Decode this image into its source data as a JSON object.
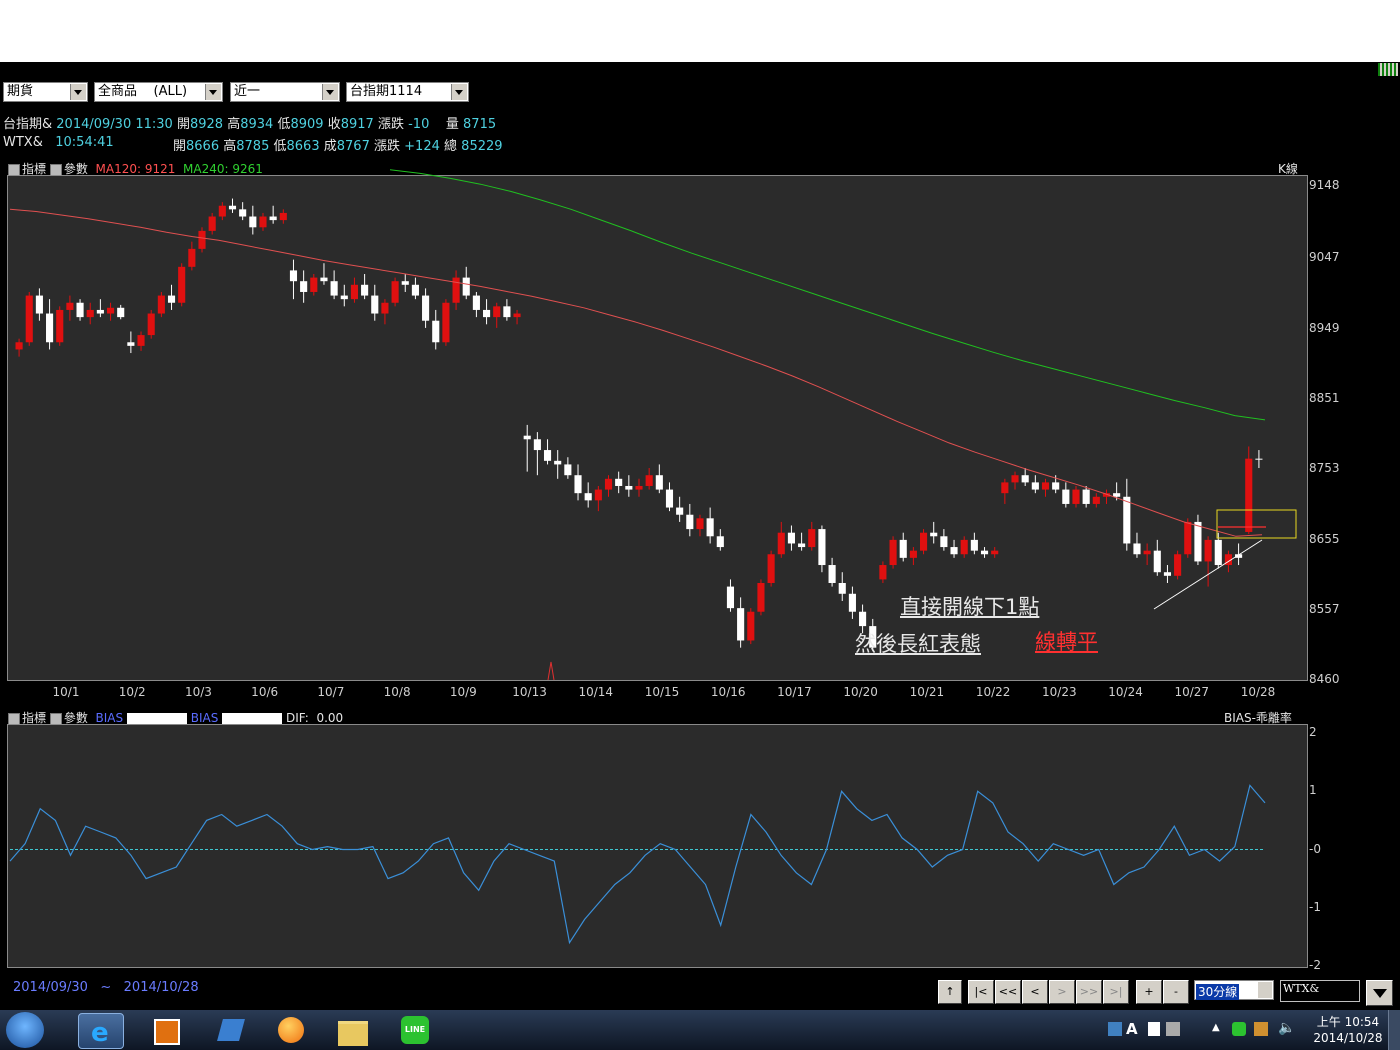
{
  "toolbar": {
    "combo1": "期貨",
    "combo2": "全商品    (ALL)",
    "combo3": "近一",
    "combo4": "台指期1114"
  },
  "quote1": {
    "name": "台指期&",
    "datetime": "2014/09/30 11:30",
    "open_label": "開",
    "open": "8928",
    "high_label": "高",
    "high": "8934",
    "low_label": "低",
    "low": "8909",
    "close_label": "收",
    "close": "8917",
    "chg_label": "漲跌",
    "chg": "-10",
    "vol_label": "量",
    "vol": "8715"
  },
  "quote2": {
    "name": "WTX&",
    "time": "10:54:41",
    "open_label": "開",
    "open": "8666",
    "high_label": "高",
    "high": "8785",
    "low_label": "低",
    "low": "8663",
    "close_label": "成",
    "close": "8767",
    "chg_label": "漲跌",
    "chg": "+124",
    "vol_label": "總",
    "vol": "85229"
  },
  "main_header": {
    "ind_label": "指標",
    "param_label": "參數",
    "ma120": "MA120: 9121",
    "ma240": "MA240: 9261",
    "chart_kind": "K線"
  },
  "sub_header": {
    "ind_label": "指標",
    "param_label": "參數",
    "bias1": "BIAS",
    "bias2": "BIAS",
    "dif_label": "DIF:",
    "dif": "0.00",
    "name": "BIAS-乖離率"
  },
  "annotations": {
    "line1": "直接開線下1點",
    "line2": "然後長紅表態",
    "line3": "線轉平"
  },
  "range": {
    "start": "2014/09/30",
    "sep": "~",
    "end": "2014/10/28"
  },
  "nav": {
    "up": "↑",
    "first": "|<",
    "prev_page": "<<",
    "prev": "<",
    "next": ">",
    "next_page": ">>",
    "last": ">|",
    "zoom_in": "+",
    "zoom_out": "-",
    "period": "30分線",
    "symbol": "WTX&"
  },
  "taskbar": {
    "clock_time": "上午 10:54",
    "clock_date": "2014/10/28"
  },
  "colors": {
    "up": "#e01010",
    "down": "#ffffff",
    "ma120": "#e05050",
    "ma240": "#20c020",
    "bias": "#3a8fd8",
    "zero": "#3fc7d0",
    "highlight": "#e8d820"
  },
  "chart_data": [
    {
      "type": "candlestick",
      "y_axis_ticks": [
        "9148",
        "9047",
        "8949",
        "8851",
        "8753",
        "8655",
        "8557",
        "8460"
      ],
      "ylim": [
        8460,
        9160
      ],
      "x_tick_labels": [
        "10/1",
        "10/2",
        "10/3",
        "10/6",
        "10/7",
        "10/8",
        "10/9",
        "10/13",
        "10/14",
        "10/15",
        "10/16",
        "10/17",
        "10/20",
        "10/21",
        "10/22",
        "10/23",
        "10/24",
        "10/27",
        "10/28"
      ],
      "candles": [
        [
          8920,
          8935,
          8910,
          8930
        ],
        [
          8930,
          9000,
          8925,
          8995
        ],
        [
          8995,
          9005,
          8960,
          8970
        ],
        [
          8970,
          8990,
          8920,
          8930
        ],
        [
          8930,
          8980,
          8925,
          8975
        ],
        [
          8975,
          8995,
          8960,
          8985
        ],
        [
          8985,
          8990,
          8960,
          8965
        ],
        [
          8965,
          8985,
          8955,
          8975
        ],
        [
          8975,
          8990,
          8965,
          8970
        ],
        [
          8970,
          8985,
          8960,
          8978
        ],
        [
          8978,
          8982,
          8962,
          8965
        ],
        [
          8930,
          8945,
          8915,
          8925
        ],
        [
          8925,
          8945,
          8918,
          8940
        ],
        [
          8940,
          8975,
          8935,
          8970
        ],
        [
          8970,
          9000,
          8965,
          8995
        ],
        [
          8995,
          9010,
          8975,
          8985
        ],
        [
          8985,
          9040,
          8980,
          9035
        ],
        [
          9035,
          9070,
          9030,
          9060
        ],
        [
          9060,
          9090,
          9055,
          9085
        ],
        [
          9085,
          9110,
          9080,
          9105
        ],
        [
          9105,
          9125,
          9100,
          9120
        ],
        [
          9120,
          9130,
          9110,
          9115
        ],
        [
          9115,
          9125,
          9100,
          9105
        ],
        [
          9105,
          9120,
          9080,
          9090
        ],
        [
          9090,
          9110,
          9085,
          9105
        ],
        [
          9105,
          9120,
          9095,
          9100
        ],
        [
          9100,
          9115,
          9095,
          9110
        ],
        [
          9030,
          9045,
          8990,
          9015
        ],
        [
          9015,
          9030,
          8985,
          9000
        ],
        [
          9000,
          9025,
          8995,
          9020
        ],
        [
          9020,
          9040,
          9010,
          9015
        ],
        [
          9015,
          9030,
          8990,
          8995
        ],
        [
          8995,
          9010,
          8980,
          8990
        ],
        [
          8990,
          9020,
          8985,
          9010
        ],
        [
          9010,
          9025,
          8990,
          8995
        ],
        [
          8995,
          9010,
          8960,
          8970
        ],
        [
          8970,
          8990,
          8955,
          8985
        ],
        [
          8985,
          9020,
          8980,
          9015
        ],
        [
          9015,
          9025,
          9000,
          9010
        ],
        [
          9010,
          9020,
          8990,
          8995
        ],
        [
          8995,
          9005,
          8950,
          8960
        ],
        [
          8960,
          8975,
          8920,
          8930
        ],
        [
          8930,
          8990,
          8925,
          8985
        ],
        [
          8985,
          9030,
          8975,
          9020
        ],
        [
          9020,
          9035,
          8990,
          8995
        ],
        [
          8995,
          9000,
          8965,
          8975
        ],
        [
          8975,
          8990,
          8955,
          8965
        ],
        [
          8965,
          8985,
          8950,
          8980
        ],
        [
          8980,
          8990,
          8960,
          8965
        ],
        [
          8965,
          8975,
          8955,
          8970
        ],
        [
          8800,
          8815,
          8750,
          8795
        ],
        [
          8795,
          8805,
          8745,
          8780
        ],
        [
          8780,
          8795,
          8760,
          8765
        ],
        [
          8765,
          8780,
          8740,
          8760
        ],
        [
          8760,
          8770,
          8740,
          8745
        ],
        [
          8745,
          8760,
          8710,
          8720
        ],
        [
          8720,
          8735,
          8700,
          8710
        ],
        [
          8710,
          8730,
          8695,
          8725
        ],
        [
          8725,
          8745,
          8715,
          8740
        ],
        [
          8740,
          8750,
          8720,
          8730
        ],
        [
          8730,
          8745,
          8715,
          8725
        ],
        [
          8725,
          8740,
          8715,
          8730
        ],
        [
          8730,
          8755,
          8725,
          8745
        ],
        [
          8745,
          8760,
          8720,
          8725
        ],
        [
          8725,
          8735,
          8695,
          8700
        ],
        [
          8700,
          8715,
          8680,
          8690
        ],
        [
          8690,
          8705,
          8660,
          8670
        ],
        [
          8670,
          8690,
          8660,
          8685
        ],
        [
          8685,
          8700,
          8650,
          8660
        ],
        [
          8660,
          8670,
          8640,
          8645
        ],
        [
          8590,
          8600,
          8555,
          8560
        ],
        [
          8560,
          8575,
          8505,
          8515
        ],
        [
          8515,
          8560,
          8510,
          8555
        ],
        [
          8555,
          8600,
          8550,
          8595
        ],
        [
          8595,
          8640,
          8590,
          8635
        ],
        [
          8635,
          8680,
          8630,
          8665
        ],
        [
          8665,
          8675,
          8640,
          8650
        ],
        [
          8650,
          8665,
          8640,
          8645
        ],
        [
          8645,
          8680,
          8640,
          8670
        ],
        [
          8670,
          8675,
          8610,
          8620
        ],
        [
          8620,
          8630,
          8590,
          8595
        ],
        [
          8595,
          8610,
          8570,
          8580
        ],
        [
          8580,
          8590,
          8545,
          8555
        ],
        [
          8555,
          8565,
          8525,
          8535
        ],
        [
          8535,
          8545,
          8500,
          8505
        ],
        [
          8600,
          8625,
          8595,
          8620
        ],
        [
          8620,
          8660,
          8615,
          8655
        ],
        [
          8655,
          8665,
          8625,
          8630
        ],
        [
          8630,
          8645,
          8620,
          8640
        ],
        [
          8640,
          8670,
          8635,
          8665
        ],
        [
          8665,
          8680,
          8650,
          8660
        ],
        [
          8660,
          8670,
          8640,
          8645
        ],
        [
          8645,
          8655,
          8630,
          8635
        ],
        [
          8635,
          8660,
          8630,
          8655
        ],
        [
          8655,
          8665,
          8635,
          8640
        ],
        [
          8640,
          8645,
          8630,
          8635
        ],
        [
          8635,
          8645,
          8630,
          8640
        ],
        [
          8720,
          8740,
          8705,
          8735
        ],
        [
          8735,
          8750,
          8725,
          8745
        ],
        [
          8745,
          8755,
          8730,
          8735
        ],
        [
          8735,
          8745,
          8720,
          8725
        ],
        [
          8725,
          8740,
          8715,
          8735
        ],
        [
          8735,
          8745,
          8720,
          8725
        ],
        [
          8725,
          8735,
          8700,
          8705
        ],
        [
          8705,
          8730,
          8700,
          8725
        ],
        [
          8725,
          8730,
          8700,
          8705
        ],
        [
          8705,
          8720,
          8700,
          8715
        ],
        [
          8715,
          8725,
          8705,
          8720
        ],
        [
          8720,
          8735,
          8710,
          8715
        ],
        [
          8715,
          8740,
          8640,
          8650
        ],
        [
          8650,
          8665,
          8630,
          8635
        ],
        [
          8635,
          8650,
          8620,
          8640
        ],
        [
          8640,
          8655,
          8605,
          8610
        ],
        [
          8610,
          8620,
          8595,
          8605
        ],
        [
          8605,
          8640,
          8600,
          8635
        ],
        [
          8635,
          8685,
          8630,
          8680
        ],
        [
          8680,
          8690,
          8620,
          8625
        ],
        [
          8625,
          8660,
          8590,
          8655
        ],
        [
          8655,
          8665,
          8615,
          8620
        ],
        [
          8620,
          8640,
          8610,
          8635
        ],
        [
          8635,
          8650,
          8620,
          8630
        ],
        [
          8666,
          8785,
          8663,
          8768
        ],
        [
          8768,
          8780,
          8755,
          8767
        ]
      ],
      "series": [
        {
          "name": "MA120",
          "values": [
            9115,
            9112,
            9107,
            9102,
            9096,
            9090,
            9083,
            9077,
            9072,
            9065,
            9058,
            9051,
            9044,
            9038,
            9032,
            9026,
            9020,
            9014,
            9008,
            9001,
            8994,
            8986,
            8978,
            8968,
            8958,
            8947,
            8935,
            8923,
            8910,
            8897,
            8883,
            8868,
            8852,
            8836,
            8820,
            8805,
            8790,
            8777,
            8765,
            8753,
            8742,
            8731,
            8719,
            8706,
            8693,
            8680,
            8670,
            8660,
            8662
          ]
        },
        {
          "name": "MA240",
          "values": [
            9170,
            9165,
            9158,
            9150,
            9140,
            9128,
            9115,
            9100,
            9085,
            9069,
            9054,
            9040,
            9026,
            9012,
            8998,
            8984,
            8970,
            8956,
            8942,
            8929,
            8916,
            8904,
            8893,
            8882,
            8871,
            8860,
            8849,
            8839,
            8828,
            8822
          ]
        }
      ]
    },
    {
      "type": "line",
      "name": "BIAS",
      "y_axis_ticks": [
        "2",
        "1",
        "-0",
        "-1",
        "-2"
      ],
      "ylim": [
        -2,
        2
      ],
      "values": [
        -0.2,
        0.1,
        0.7,
        0.5,
        -0.1,
        0.4,
        0.3,
        0.2,
        -0.1,
        -0.5,
        -0.4,
        -0.3,
        0.1,
        0.5,
        0.6,
        0.4,
        0.5,
        0.6,
        0.4,
        0.1,
        0.0,
        0.05,
        0.0,
        0.0,
        0.05,
        -0.5,
        -0.4,
        -0.2,
        0.1,
        0.2,
        -0.4,
        -0.7,
        -0.2,
        0.1,
        0.0,
        -0.1,
        -0.2,
        -1.6,
        -1.2,
        -0.9,
        -0.6,
        -0.4,
        -0.1,
        0.1,
        0.0,
        -0.3,
        -0.6,
        -1.3,
        -0.3,
        0.6,
        0.3,
        -0.1,
        -0.4,
        -0.6,
        0.0,
        1.0,
        0.7,
        0.5,
        0.6,
        0.2,
        0.0,
        -0.3,
        -0.1,
        0.0,
        1.0,
        0.8,
        0.3,
        0.1,
        -0.2,
        0.1,
        0.0,
        -0.1,
        0.0,
        -0.6,
        -0.4,
        -0.3,
        0.0,
        0.4,
        -0.1,
        0.0,
        -0.2,
        0.05,
        1.1,
        0.8
      ]
    }
  ]
}
